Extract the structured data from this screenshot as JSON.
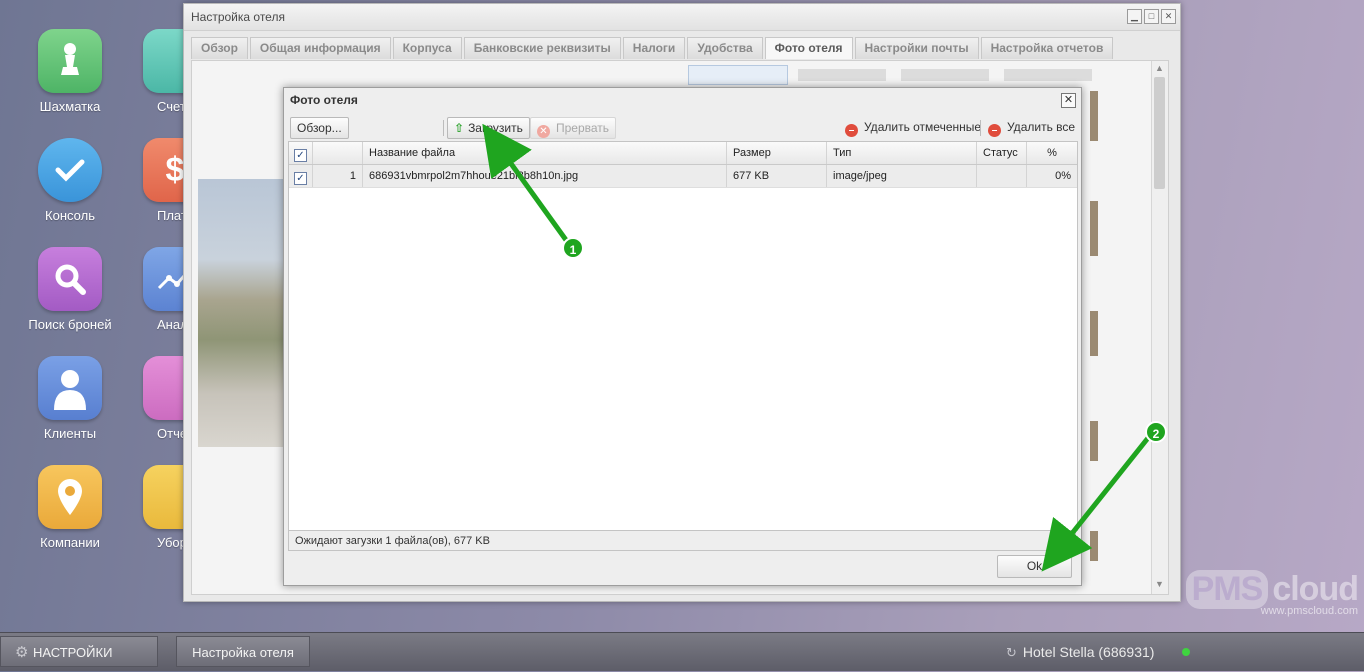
{
  "desktop": {
    "icons": [
      {
        "label": "Шахматка"
      },
      {
        "label": "Консоль"
      },
      {
        "label": "Поиск броней"
      },
      {
        "label": "Клиенты"
      },
      {
        "label": "Компании"
      },
      {
        "label": "Счет"
      },
      {
        "label": "Плате"
      },
      {
        "label": "Анали"
      },
      {
        "label": "Отче"
      },
      {
        "label": "Убор"
      }
    ]
  },
  "window": {
    "title": "Настройка отеля",
    "tabs": [
      {
        "label": "Обзор"
      },
      {
        "label": "Общая информация"
      },
      {
        "label": "Корпуса"
      },
      {
        "label": "Банковские реквизиты"
      },
      {
        "label": "Налоги"
      },
      {
        "label": "Удобства"
      },
      {
        "label": "Фото отеля",
        "active": true
      },
      {
        "label": "Настройки почты"
      },
      {
        "label": "Настройка отчетов"
      }
    ]
  },
  "dialog": {
    "title": "Фото отеля",
    "toolbar": {
      "browse": "Обзор...",
      "upload": "Загрузить",
      "abort": "Прервать",
      "delete_selected": "Удалить отмеченные",
      "delete_all": "Удалить все"
    },
    "columns": {
      "filename": "Название файла",
      "size": "Размер",
      "type": "Тип",
      "status": "Статус",
      "percent": "%"
    },
    "rows": [
      {
        "index": "1",
        "filename": "686931vbmrpol2m7hhoue21bl8b8h10n.jpg",
        "size": "677 KB",
        "type": "image/jpeg",
        "status": "",
        "percent": "0%"
      }
    ],
    "status_text": "Ожидают загузки 1 файла(ов), 677 KB",
    "ok_label": "Ok"
  },
  "annotations": {
    "badge1": "1",
    "badge2": "2",
    "arrow_color": "#1fa51f"
  },
  "watermark": {
    "logo_a": "PMS",
    "logo_b": "cloud",
    "url": "www.pmscloud.com"
  },
  "taskbar": {
    "settings_label": "НАСТРОЙКИ",
    "window_label": "Настройка отеля",
    "hotel": "Hotel Stella (686931)"
  }
}
